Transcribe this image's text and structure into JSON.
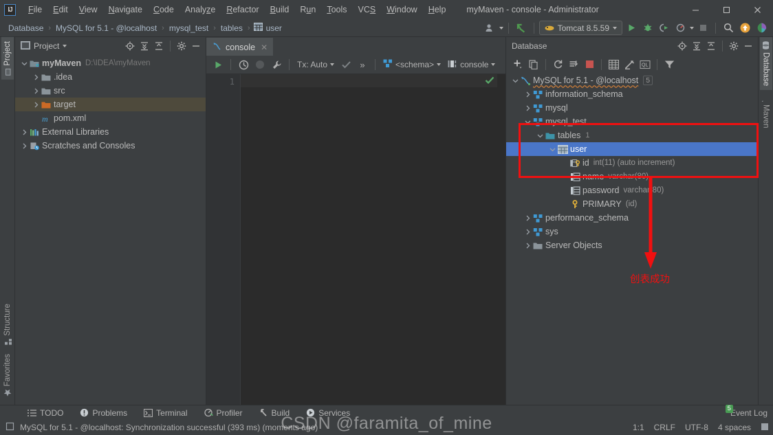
{
  "window": {
    "title": "myMaven - console - Administrator",
    "minimize": "—",
    "maximize": "☐",
    "close": "✕"
  },
  "menu": {
    "items": [
      "File",
      "Edit",
      "View",
      "Navigate",
      "Code",
      "Analyze",
      "Refactor",
      "Build",
      "Run",
      "Tools",
      "VCS",
      "Window",
      "Help"
    ]
  },
  "breadcrumb": {
    "items": [
      "Database",
      "MySQL for 5.1 - @localhost",
      "mysql_test",
      "tables",
      "user"
    ],
    "separator": "›"
  },
  "toolbar": {
    "run_config": "Tomcat 8.5.59",
    "run_title": "Run",
    "debug_title": "Debug",
    "coverage_title": "Run with Coverage",
    "profile_title": "Profiler",
    "stop_title": "Stop",
    "search_title": "Search Everywhere",
    "update_title": "Update Project",
    "settings_title": "Settings"
  },
  "stripe_left": {
    "tabs": [
      {
        "label": "Project",
        "icon": "project-icon",
        "active": true
      },
      {
        "label": "Structure",
        "icon": "structure-icon",
        "active": false
      },
      {
        "label": "Favorites",
        "icon": "star-icon",
        "active": false
      }
    ]
  },
  "stripe_right": {
    "tabs": [
      {
        "label": "Database",
        "icon": "database-icon",
        "active": true
      },
      {
        "label": "Maven",
        "icon": "maven-icon",
        "active": false
      }
    ]
  },
  "project_panel": {
    "title": "Project",
    "tree": [
      {
        "label": "myMaven",
        "sub": "D:\\IDEA\\myMaven",
        "arrow": "∨",
        "icon": "module-icon",
        "indent": 0,
        "bold": true,
        "selected": false
      },
      {
        "label": ".idea",
        "sub": "",
        "arrow": "›",
        "icon": "folder-icon",
        "indent": 1,
        "bold": false,
        "selected": false
      },
      {
        "label": "src",
        "sub": "",
        "arrow": "›",
        "icon": "folder-icon",
        "indent": 1,
        "bold": false,
        "selected": false
      },
      {
        "label": "target",
        "sub": "",
        "arrow": "›",
        "icon": "folder-orange-icon",
        "indent": 1,
        "bold": false,
        "selected": "olive"
      },
      {
        "label": "pom.xml",
        "sub": "",
        "arrow": "",
        "icon": "maven-file-icon",
        "indent": 1,
        "bold": false,
        "selected": false
      },
      {
        "label": "External Libraries",
        "sub": "",
        "arrow": "›",
        "icon": "libraries-icon",
        "indent": 0,
        "bold": false,
        "selected": false
      },
      {
        "label": "Scratches and Consoles",
        "sub": "",
        "arrow": "›",
        "icon": "scratches-icon",
        "indent": 0,
        "bold": false,
        "selected": false
      }
    ]
  },
  "editor": {
    "tab_label": "console",
    "tab_close": "✕",
    "toolbar": {
      "execute_title": "Execute",
      "history_title": "History",
      "stop_title": "Stop",
      "wrench_title": "Data Source Properties",
      "tx_label": "Tx: Auto",
      "commit_title": "Commit",
      "more": "»",
      "schema_label": "<schema>",
      "session_label": "console"
    },
    "line_number": "1",
    "content": ""
  },
  "database_panel": {
    "title": "Database",
    "toolbar": {
      "add_title": "New",
      "copy_title": "Duplicate",
      "refresh_title": "Refresh",
      "sync_title": "Synchronize",
      "stop_title": "Stop",
      "table_title": "Open Table Editor",
      "edit_title": "Modify",
      "ql_title": "Jump to Query Console",
      "filter_title": "Filter"
    },
    "tree": [
      {
        "label": "MySQL for 5.1 - @localhost",
        "detail": "",
        "count": "5",
        "arrow": "∨",
        "icon": "mysql-icon",
        "indent": 0,
        "style": "wavy",
        "selected": false
      },
      {
        "label": "information_schema",
        "detail": "",
        "count": "",
        "arrow": "›",
        "icon": "schema-icon",
        "indent": 1,
        "style": "",
        "selected": false
      },
      {
        "label": "mysql",
        "detail": "",
        "count": "",
        "arrow": "›",
        "icon": "schema-icon",
        "indent": 1,
        "style": "",
        "selected": false
      },
      {
        "label": "mysql_test",
        "detail": "",
        "count": "",
        "arrow": "∨",
        "icon": "schema-icon",
        "indent": 1,
        "style": "",
        "selected": false
      },
      {
        "label": "tables",
        "detail": "",
        "count": "1",
        "arrow": "∨",
        "icon": "folder-teal-icon",
        "indent": 2,
        "style": "",
        "selected": false
      },
      {
        "label": "user",
        "detail": "",
        "count": "",
        "arrow": "∨",
        "icon": "table-icon",
        "indent": 3,
        "style": "",
        "selected": true
      },
      {
        "label": "id",
        "detail": "int(11) (auto increment)",
        "count": "",
        "arrow": "",
        "icon": "column-key-icon",
        "indent": 4,
        "style": "",
        "selected": false
      },
      {
        "label": "name",
        "detail": "varchar(80)",
        "count": "",
        "arrow": "",
        "icon": "column-icon",
        "indent": 4,
        "style": "",
        "selected": false
      },
      {
        "label": "password",
        "detail": "varchar(80)",
        "count": "",
        "arrow": "",
        "icon": "column-icon",
        "indent": 4,
        "style": "",
        "selected": false
      },
      {
        "label": "PRIMARY",
        "detail": "(id)",
        "count": "",
        "arrow": "",
        "icon": "key-icon",
        "indent": 4,
        "style": "",
        "selected": false
      },
      {
        "label": "performance_schema",
        "detail": "",
        "count": "",
        "arrow": "›",
        "icon": "schema-icon",
        "indent": 1,
        "style": "",
        "selected": false
      },
      {
        "label": "sys",
        "detail": "",
        "count": "",
        "arrow": "›",
        "icon": "schema-icon",
        "indent": 1,
        "style": "",
        "selected": false
      },
      {
        "label": "Server Objects",
        "detail": "",
        "count": "",
        "arrow": "›",
        "icon": "folder-icon",
        "indent": 1,
        "style": "",
        "selected": false
      }
    ]
  },
  "annotation": {
    "text": "创表成功",
    "color": "#f11010"
  },
  "bottom_tools": [
    {
      "label": "TODO",
      "icon": "todo-icon"
    },
    {
      "label": "Problems",
      "icon": "problems-icon"
    },
    {
      "label": "Terminal",
      "icon": "terminal-icon"
    },
    {
      "label": "Profiler",
      "icon": "profiler-icon"
    },
    {
      "label": "Build",
      "icon": "build-icon"
    },
    {
      "label": "Services",
      "icon": "services-icon"
    }
  ],
  "status": {
    "message": "MySQL for 5.1 - @localhost: Synchronization successful (393 ms) (moments ago)",
    "caret": "1:1",
    "line_sep": "CRLF",
    "encoding": "UTF-8",
    "indent": "4 spaces",
    "event_log": "Event Log",
    "event_count": "5"
  },
  "watermark": {
    "text": "CSDN @faramita_of_mine"
  }
}
